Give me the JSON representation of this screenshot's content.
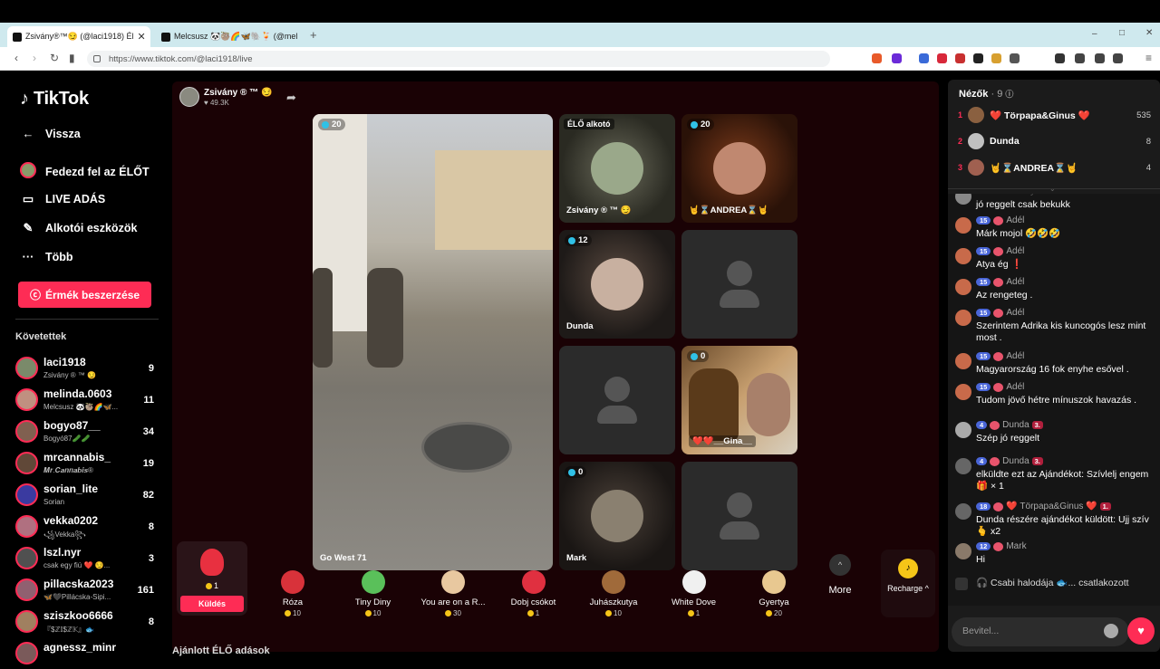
{
  "browser": {
    "tabs": [
      {
        "title": "Zsivány®™😏 (@laci1918) Él",
        "active": true
      },
      {
        "title": "Melcsusz 🐼🦥🌈🦋🐘🍹 (@mel",
        "active": false
      }
    ],
    "new_tab": "+",
    "url": "https://www.tiktok.com/@laci1918/live",
    "window_controls": [
      "–",
      "□",
      "✕"
    ]
  },
  "sidebar": {
    "logo": "TikTok",
    "nav": [
      {
        "label": "Vissza",
        "icon": "arrow-left-icon"
      },
      {
        "label": "Fedezd fel az ÉLŐT",
        "icon": "avatar-icon"
      },
      {
        "label": "LIVE ADÁS",
        "icon": "video-camera-icon"
      },
      {
        "label": "Alkotói eszközök",
        "icon": "lightbulb-icon"
      },
      {
        "label": "Több",
        "icon": "more-dots-icon"
      }
    ],
    "coins_button": "Érmék beszerzése",
    "following_header": "Követettek",
    "following": [
      {
        "name": "laci1918",
        "sub": "Zsivány ® ™ 😏",
        "count": "9",
        "color": "#7a8a6a"
      },
      {
        "name": "melinda.0603",
        "sub": "Melcsusz 🐼🦥🌈🦋...",
        "count": "11",
        "color": "#c09080"
      },
      {
        "name": "bogyo87__",
        "sub": "Bogyó87🥒🥒",
        "count": "34",
        "color": "#806050"
      },
      {
        "name": "mrcannabis_",
        "sub": "𝑴𝒓.𝑪𝒂𝒏𝒏𝒂𝒃𝒊𝒔®",
        "count": "19",
        "color": "#604838"
      },
      {
        "name": "sorian_lite",
        "sub": "Sorian",
        "count": "82",
        "color": "#3a3aa0"
      },
      {
        "name": "vekka0202",
        "sub": "꧁Vekka꧂",
        "count": "8",
        "color": "#b07080"
      },
      {
        "name": "lszl.nyr",
        "sub": "csak egy fiú ❤️ 😏...",
        "count": "3",
        "color": "#505050"
      },
      {
        "name": "pillacska2023",
        "sub": "🦋🖤Pillácska-Sipi...",
        "count": "161",
        "color": "#906070"
      },
      {
        "name": "sziszkoo6666",
        "sub": "『$ℤ𝕀$ℤ𝕂』🐟",
        "count": "8",
        "color": "#a08060"
      },
      {
        "name": "agnessz_minr",
        "sub": "",
        "count": "",
        "color": "#7a5a5a"
      }
    ]
  },
  "host": {
    "name": "Zsivány ® ™ 😏",
    "likes": "♥ 49.3K"
  },
  "tiles": {
    "main": {
      "count": "20",
      "label": "Go West 71"
    },
    "creator_badge": "ÉLŐ alkotó",
    "creator": {
      "name": "Zsivány ® ™ 😏"
    },
    "andrea": {
      "count": "20",
      "name": "🤘⌛ANDREA⌛🤘"
    },
    "dunda": {
      "count": "12",
      "name": "Dunda"
    },
    "gina": {
      "count": "0",
      "name": "❤️❤️__Gina__"
    },
    "mark": {
      "count": "0",
      "name": "Mark"
    }
  },
  "gifts": {
    "selected": {
      "price": "1",
      "send_label": "Küldés"
    },
    "items": [
      {
        "name": "Róza",
        "price": "10",
        "color": "#d8323a"
      },
      {
        "name": "Tiny Diny",
        "price": "10",
        "color": "#5ac05a"
      },
      {
        "name": "You are on a R...",
        "price": "30",
        "color": "#e8c8a0"
      },
      {
        "name": "Dobj csókot",
        "price": "1",
        "color": "#e03040"
      },
      {
        "name": "Juhászkutya",
        "price": "10",
        "color": "#a06a3a"
      },
      {
        "name": "White Dove",
        "price": "1",
        "color": "#f0f0f0"
      },
      {
        "name": "Gyertya",
        "price": "20",
        "color": "#e8c890"
      }
    ],
    "more": "More",
    "recharge": "Recharge ^"
  },
  "viewers": {
    "title": "Nézők",
    "count": "· 9",
    "list": [
      {
        "rank": "1",
        "name": "❤️ Törpapa&Ginus ❤️",
        "score": "535",
        "color": "#8a6040"
      },
      {
        "rank": "2",
        "name": "Dunda",
        "score": "8",
        "color": "#c0c0c0"
      },
      {
        "rank": "3",
        "name": "🤘⌛ANDREA⌛🤘",
        "score": "4",
        "color": "#a06050"
      }
    ]
  },
  "chat": [
    {
      "user": "Tekovari Kiraly",
      "text": "jó reggelt csak bekukk",
      "level": "",
      "rank": ""
    },
    {
      "user": "Adél",
      "text": "Márk mojol 🤣🤣🤣",
      "level": "15",
      "rank": ""
    },
    {
      "user": "Adél",
      "text": "Atya ég ❗",
      "level": "15",
      "rank": ""
    },
    {
      "user": "Adél",
      "text": "Az rengeteg .",
      "level": "15",
      "rank": ""
    },
    {
      "user": "Adél",
      "text": "Szerintem Adrika kis kuncogós lesz mint most .",
      "level": "15",
      "rank": ""
    },
    {
      "user": "Adél",
      "text": "Magyarország 16 fok enyhe esővel .",
      "level": "15",
      "rank": ""
    },
    {
      "user": "Adél",
      "text": "Tudom jövő hétre mínuszok havazás .",
      "level": "15",
      "rank": ""
    },
    {
      "user": "Dunda",
      "text": "Szép jó reggelt",
      "level": "4",
      "rank": "3."
    },
    {
      "user": "Dunda",
      "text": "elküldte ezt az Ajándékot: Szívlelj engem 🎁 × 1",
      "level": "4",
      "rank": "3."
    },
    {
      "user": "❤️ Törpapa&Ginus ❤️",
      "text": "Dunda részére ajándékot küldött: Ujj szív 🫰 x2",
      "level": "18",
      "rank": "1."
    },
    {
      "user": "Mark",
      "text": "Hi",
      "level": "12",
      "rank": ""
    },
    {
      "user": "🎧 Csabi halodája 🐟...",
      "text": "csatlakozott",
      "level": "",
      "rank": ""
    }
  ],
  "input_placeholder": "Bevitel...",
  "bottom_section": "Ajánlott ÉLŐ adások"
}
